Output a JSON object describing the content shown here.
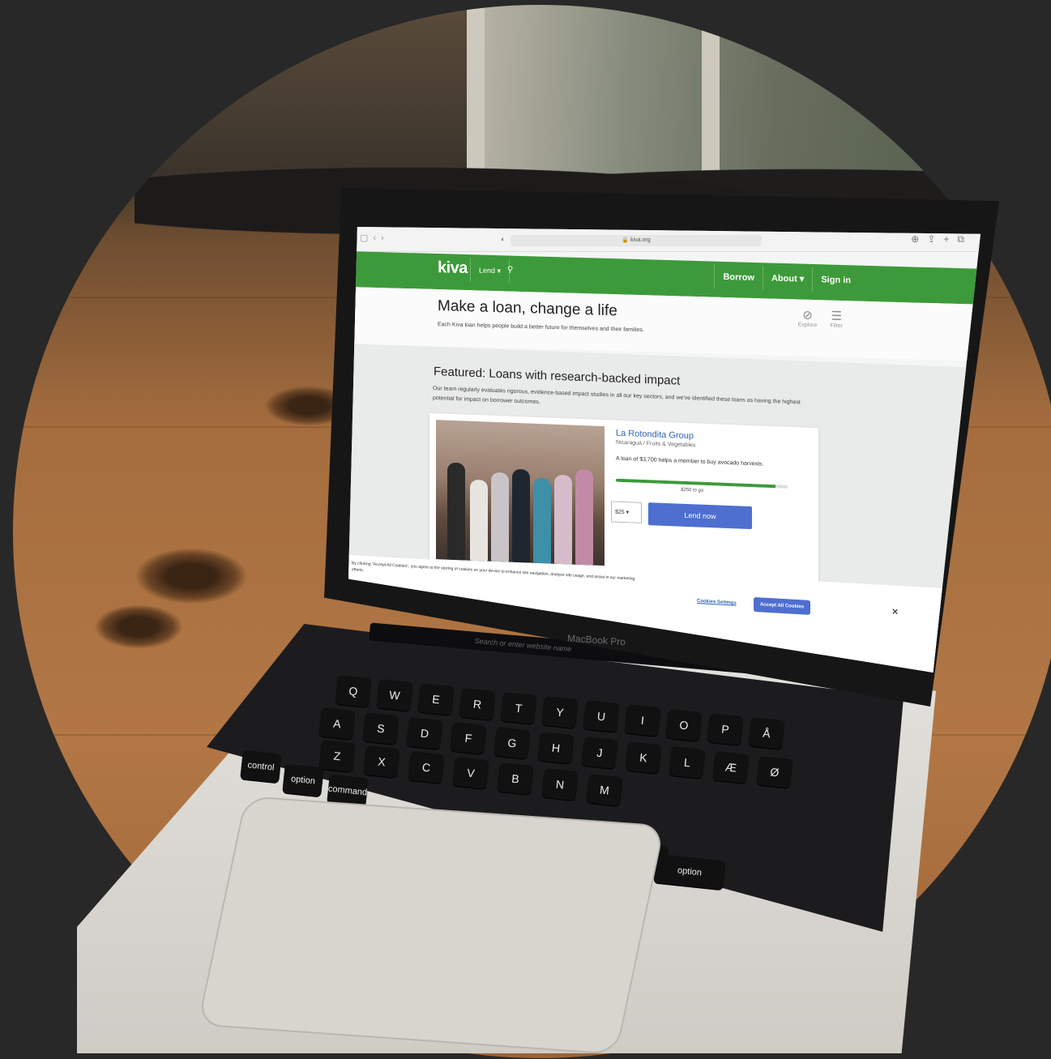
{
  "device": {
    "brand": "MacBook Pro",
    "touchbar_search": "Search or enter website name"
  },
  "browser": {
    "url": "kiva.org",
    "icons": [
      "sidebar-icon",
      "back-icon",
      "forward-icon",
      "shield-icon",
      "reload-icon",
      "download-icon",
      "share-icon",
      "new-tab-icon",
      "tabs-icon"
    ]
  },
  "nav": {
    "logo": "kiva",
    "lend": "Lend",
    "borrow": "Borrow",
    "about": "About",
    "sign_in": "Sign in"
  },
  "hero": {
    "title": "Make a loan, change a life",
    "subtitle": "Each Kiva loan helps people build a better future for themselves and their families.",
    "explore": "Explore",
    "filter": "Filter"
  },
  "featured": {
    "title": "Featured: Loans with research-backed impact",
    "description": "Our team regularly evaluates rigorous, evidence-based impact studies in all our key sectors, and we've identified these loans as having the highest potential for impact on borrower outcomes."
  },
  "loan": {
    "name": "La Rotondita Group",
    "location": "Nicaragua / Fruits & Vegetables",
    "description": "A loan of $3,700 helps a member to buy avocado harvests.",
    "to_go": "$250 to go",
    "funded_fraction": 0.93,
    "amount": "$25",
    "lend_label": "Lend now"
  },
  "cookies": {
    "text": "By clicking \"Accept All Cookies\", you agree to the storing of cookies on your device to enhance site navigation, analyze site usage, and assist in our marketing efforts.",
    "settings": "Cookies Settings",
    "accept": "Accept All Cookies"
  },
  "keyboard": {
    "row1": [
      "Q",
      "W",
      "E",
      "R",
      "T",
      "Y",
      "U",
      "I",
      "O",
      "P",
      "Å"
    ],
    "row2": [
      "A",
      "S",
      "D",
      "F",
      "G",
      "H",
      "J",
      "K",
      "L",
      "Æ",
      "Ø"
    ],
    "row3": [
      "Z",
      "X",
      "C",
      "V",
      "B",
      "N",
      "M"
    ],
    "mods": [
      "control",
      "option",
      "command",
      "command",
      "option"
    ]
  },
  "colors": {
    "kiva_green": "#3d9a3a",
    "lend_blue": "#4e6fd0",
    "link_blue": "#2c64b5"
  }
}
